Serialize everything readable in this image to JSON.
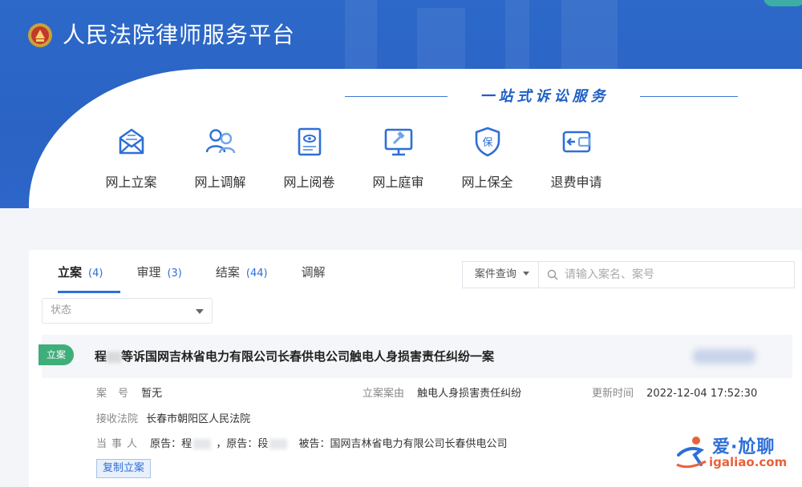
{
  "header": {
    "site_title": "人民法院律师服务平台",
    "slogan": "一站式诉讼服务"
  },
  "services": [
    {
      "label": "网上立案",
      "icon": "envelope-icon"
    },
    {
      "label": "网上调解",
      "icon": "users-icon"
    },
    {
      "label": "网上阅卷",
      "icon": "document-eye-icon"
    },
    {
      "label": "网上庭审",
      "icon": "monitor-gavel-icon"
    },
    {
      "label": "网上保全",
      "icon": "shield-bao-icon"
    },
    {
      "label": "退费申请",
      "icon": "wallet-return-icon"
    }
  ],
  "tabs": [
    {
      "label": "立案",
      "count": "(4)"
    },
    {
      "label": "审理",
      "count": "(3)"
    },
    {
      "label": "结案",
      "count": "(44)"
    },
    {
      "label": "调解",
      "count": ""
    }
  ],
  "search": {
    "query_type": "案件查询",
    "placeholder": "请输入案名、案号"
  },
  "filter": {
    "status_placeholder": "状态"
  },
  "case": {
    "badge": "立案",
    "title_prefix": "程",
    "title_rest": "等诉国网吉林省电力有限公司长春供电公司触电人身损害责任纠纷一案",
    "case_no_label": "案号",
    "case_no": "暂无",
    "cause_label": "立案案由",
    "cause": "触电人身损害责任纠纷",
    "updated_label": "更新时间",
    "updated": "2022-12-04 17:52:30",
    "court_label": "接收法院",
    "court": "长春市朝阳区人民法院",
    "parties_label": "当事人",
    "plaintiff1_label": "原告：程",
    "plaintiff2_label": "，原告：段",
    "defendant": "被告：国网吉林省电力有限公司长春供电公司",
    "copy_button": "复制立案"
  },
  "watermark": {
    "text": "爱·尬聊",
    "url": "igaliao.com"
  },
  "colors": {
    "brand_blue": "#2a63c4",
    "accent": "#2e6fd6",
    "badge_green": "#3fae7a"
  }
}
